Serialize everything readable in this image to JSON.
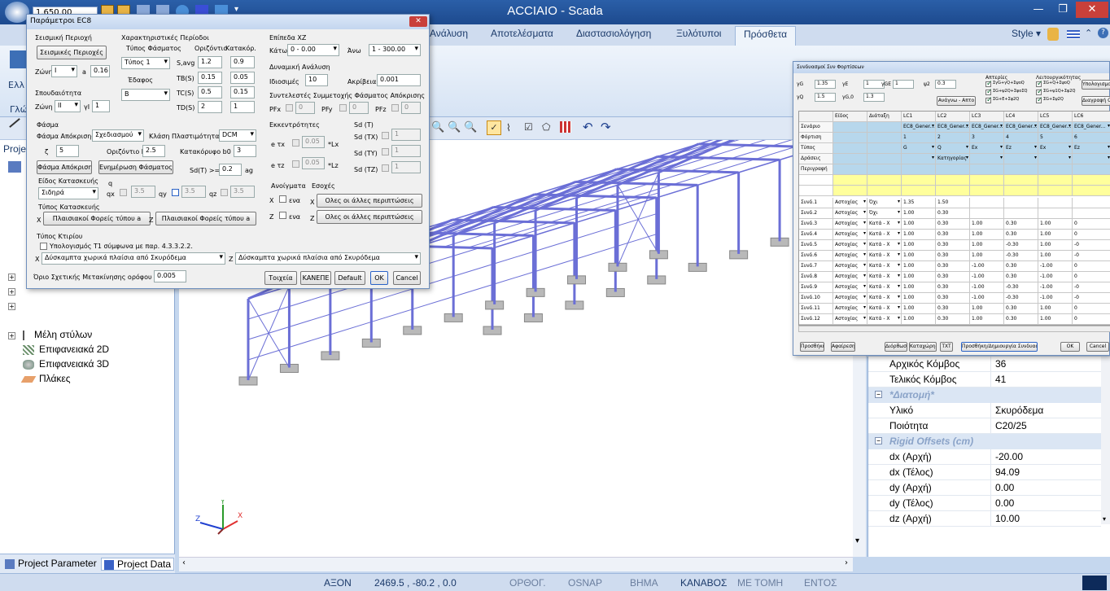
{
  "window": {
    "title": "ACCIAIO - Scada"
  },
  "quick_access": {
    "zoom_value": "1.650.00"
  },
  "ribbon": {
    "tabs": [
      "Ανάλυση",
      "Αποτελέσματα",
      "Διαστασιολόγηση",
      "Ξυλότυποι",
      "Πρόσθετα"
    ],
    "active_tab": "Πρόσθετα",
    "style_label": "Style",
    "left_group_label": "Ελλ",
    "left_group_caption": "Γλώ"
  },
  "left_panel": {
    "header": "Proje",
    "tree": [
      "Μέλη στύλων",
      "Επιφανειακά 2D",
      "Επιφανειακά 3D",
      "Πλάκες"
    ],
    "bottom_tabs": [
      "Project Parameter",
      "Project Data"
    ]
  },
  "status_bar": {
    "axis": "ΑΞΟΝ",
    "coords": "2469.5 , -80.2 , 0.0",
    "items": [
      "ΟΡΘΟΓ.",
      "OSNAP",
      "ΒΗΜΑ",
      "ΚΑΝΑΒΟΣ",
      "ΜΕ ΤΟΜΗ",
      "ΕΝΤΟΣ"
    ],
    "active": "ΚΑΝΑΒΟΣ"
  },
  "axes_labels": {
    "x": "X",
    "y": "Y",
    "z": "Z"
  },
  "properties": {
    "rows_top": [
      {
        "key": "Αρχικός Κόμβος",
        "value": "36"
      },
      {
        "key": "Τελικός Κόμβος",
        "value": "41"
      }
    ],
    "category_section": "*Διατομή*",
    "rows_section": [
      {
        "key": "Υλικό",
        "value": "Σκυρόδεμα"
      },
      {
        "key": "Ποιότητα",
        "value": "C20/25"
      }
    ],
    "category_offsets": "Rigid Offsets (cm)",
    "rows_offsets": [
      {
        "key": "dx (Αρχή)",
        "value": "-20.00"
      },
      {
        "key": "dx (Τέλος)",
        "value": "94.09"
      },
      {
        "key": "dy (Αρχή)",
        "value": "0.00"
      },
      {
        "key": "dy (Τέλος)",
        "value": "0.00"
      },
      {
        "key": "dz (Αρχή)",
        "value": "10.00"
      }
    ]
  },
  "ec8_dialog": {
    "title": "Παράμετροι EC8",
    "seismic_area": {
      "group": "Σεισμική Περιοχή",
      "button": "Σεισμικές Περιοχές",
      "zone_label": "Ζώνη",
      "zone_value": "I",
      "a_label": "a",
      "a_value": "0.16"
    },
    "importance": {
      "group": "Σπουδαιότητα",
      "zone_label": "Ζώνη",
      "zone_value": "II",
      "gamma_label": "γI",
      "gamma_value": "1"
    },
    "char_periods": {
      "group": "Χαρακτηριστικές Περίοδοι",
      "type_label": "Τύπος Φάσματος",
      "type_value": "Τύπος 1",
      "soil_label": "Έδαφος",
      "soil_value": "B",
      "horizontal": "Οριζόντιο",
      "vertical": "Κατακόρ.",
      "rows": [
        {
          "k": "S,avg",
          "h": "1.2",
          "v": "0.9"
        },
        {
          "k": "TB(S)",
          "h": "0.15",
          "v": "0.05"
        },
        {
          "k": "TC(S)",
          "h": "0.5",
          "v": "0.15"
        },
        {
          "k": "TD(S)",
          "h": "2",
          "v": "1"
        }
      ]
    },
    "xz_level": {
      "group": "Επίπεδα XZ",
      "below_label": "Κάτω",
      "below_value": "0 - 0.00",
      "above_label": "Άνω",
      "above_value": "1 - 300.00"
    },
    "dynamic": {
      "group": "Δυναμική Ανάλυση",
      "modes_label": "Ιδιοσιμές",
      "modes_value": "10",
      "accuracy_label": "Ακρίβεια",
      "accuracy_value": "0.001"
    },
    "participation": {
      "group": "Συντελεστές Συμμετοχής Φάσματος Απόκρισης",
      "items": [
        {
          "k": "PFx",
          "v": "0"
        },
        {
          "k": "PFy",
          "v": "0"
        },
        {
          "k": "PFz",
          "v": "0"
        }
      ]
    },
    "spectrum": {
      "group": "Φάσμα",
      "response_label": "Φάσμα Απόκρισης",
      "response_value": "Σχεδιασμού",
      "ductility_label": "Κλάση Πλαστιμότητας",
      "ductility_value": "DCM",
      "zeta_label": "ζ",
      "zeta_value": "5",
      "hb0_label": "Οριζόντιο b0",
      "hb0_value": "2.5",
      "vb0_label": "Κατακόρυφο b0",
      "vb0_value": "3",
      "btn_response": "Φάσμα Απόκρισης",
      "btn_update": "Ενημέρωση Φάσματος",
      "sd_label": "Sd(T) >=",
      "sd_value": "0.2",
      "sd_unit": "ag"
    },
    "eccentricities": {
      "group": "Εκκεντρότητες",
      "etx": "e τx",
      "etx_value": "0.05",
      "etx_unit": "*Lx",
      "etz": "e τz",
      "etz_value": "0.05",
      "etz_unit": "*Lz"
    },
    "sdt": {
      "group": "Sd (T)",
      "items": [
        {
          "k": "Sd (TX)",
          "v": "1"
        },
        {
          "k": "Sd (TY)",
          "v": "1"
        },
        {
          "k": "Sd (TZ)",
          "v": "1"
        }
      ]
    },
    "construction": {
      "group": "Είδος Κατασκευής",
      "value": "Σιδηρά",
      "q_label": "q",
      "qx": "qx",
      "qx_value": "3.5",
      "qy": "qy",
      "qy_value": "3.5",
      "qz": "qz",
      "qz_value": "3.5"
    },
    "openings": {
      "group": "Ανοίγματα",
      "x_label": "X",
      "x_text": "ενα",
      "z_label": "Z",
      "z_text": "ενα"
    },
    "recesses": {
      "group": "Εσοχές",
      "x_label": "X",
      "x_btn": "Ολες οι άλλες περιπτώσεις",
      "z_label": "Z",
      "z_btn": "Ολες οι άλλες περιπτώσεις"
    },
    "construction_type": {
      "group": "Τύπος Κατασκευής",
      "x_label": "X",
      "x_btn": "Πλαισιακοί Φορείς τύπου a",
      "z_label": "Z",
      "z_btn": "Πλαισιακοί Φορείς τύπου a"
    },
    "building_type": {
      "group": "Τύπος Κτιρίου",
      "check_label": "Υπολογισμός T1 σύμφωνα με παρ. 4.3.3.2.2.",
      "x_label": "X",
      "x_value": "Δύσκαμπτα χωρικά πλαίσια από Σκυρόδεμα",
      "z_label": "Z",
      "z_value": "Δύσκαμπτα χωρικά πλαίσια από Σκυρόδεμα"
    },
    "drift_label": "Όριο Σχετικής Μετακίνησης ορόφου",
    "drift_value": "0.005",
    "buttons": {
      "wall": "Τοιχεία",
      "none": "ΚΑΝΕΠΕ",
      "default": "Default",
      "ok": "OK",
      "cancel": "Cancel"
    }
  },
  "combos_dialog": {
    "title": "Συνδυασμοί Συν Φορτίσεων",
    "factors": [
      {
        "k": "γG",
        "v": "1.35"
      },
      {
        "k": "γE",
        "v": "1"
      },
      {
        "k": "γGE",
        "v": "1"
      },
      {
        "k": "ψ2",
        "v": "0.3"
      },
      {
        "k": "γQ",
        "v": "1.5"
      },
      {
        "k": "γG,0",
        "v": "1.3"
      }
    ],
    "btn_read": "Ανάγνω - Απτο",
    "checks_a_title": "Απτερίες",
    "checks_a": [
      "ΣγG+γQ+ΣψοQ",
      "ΣG+ψ2Q+ΣψοΣQ",
      "ΣG+E+Σψ2Q"
    ],
    "checks_b_title": "Λειτουργικότητας",
    "checks_b": [
      "ΣG+Q+ΣψοQ",
      "ΣG+ψ1Q+Σψ2Q",
      "ΣG+Σψ2Q"
    ],
    "btn_calc": "Υπολογισμοί",
    "btn_display": "Διαγραφή Ολ.",
    "col_headers": [
      "Είδος",
      "Διάταξη",
      "LC1",
      "LC2",
      "LC3",
      "LC4",
      "LC5",
      "LC6"
    ],
    "row_labels": [
      "Σενάριο",
      "Φόρτιση",
      "Τύπος",
      "Δράσεις",
      "Περιγραφή"
    ],
    "scenario_row": [
      "EC8_Gener...",
      "EC8_Gener...",
      "EC8_Gener...",
      "EC8_Gener...",
      "EC8_Gener...",
      "EC8_Gener..."
    ],
    "load_row": [
      "1",
      "2",
      "3",
      "4",
      "5",
      "6"
    ],
    "type_row": [
      "G",
      "Q",
      "Ex",
      "Ez",
      "Ex",
      "Ez"
    ],
    "action_row": [
      "",
      "Κατηγορίας",
      "",
      "",
      "",
      ""
    ],
    "combos": [
      {
        "name": "Συνδ.1",
        "kind": "Αστοχίας",
        "arr": "Όχι",
        "v": [
          "1.35",
          "1.50",
          "",
          "",
          "",
          ""
        ]
      },
      {
        "name": "Συνδ.2",
        "kind": "Αστοχίας",
        "arr": "Όχι",
        "v": [
          "1.00",
          "0.30",
          "",
          "",
          "",
          ""
        ]
      },
      {
        "name": "Συνδ.3",
        "kind": "Αστοχίας",
        "arr": "Κατά - X",
        "v": [
          "1.00",
          "0.30",
          "1.00",
          "0.30",
          "1.00",
          "0"
        ]
      },
      {
        "name": "Συνδ.4",
        "kind": "Αστοχίας",
        "arr": "Κατά - X",
        "v": [
          "1.00",
          "0.30",
          "1.00",
          "0.30",
          "1.00",
          "0"
        ]
      },
      {
        "name": "Συνδ.5",
        "kind": "Αστοχίας",
        "arr": "Κατά - X",
        "v": [
          "1.00",
          "0.30",
          "1.00",
          "-0.30",
          "1.00",
          "-0"
        ]
      },
      {
        "name": "Συνδ.6",
        "kind": "Αστοχίας",
        "arr": "Κατά - X",
        "v": [
          "1.00",
          "0.30",
          "1.00",
          "-0.30",
          "1.00",
          "-0"
        ]
      },
      {
        "name": "Συνδ.7",
        "kind": "Αστοχίας",
        "arr": "Κατά - X",
        "v": [
          "1.00",
          "0.30",
          "-1.00",
          "0.30",
          "-1.00",
          "0"
        ]
      },
      {
        "name": "Συνδ.8",
        "kind": "Αστοχίας",
        "arr": "Κατά - X",
        "v": [
          "1.00",
          "0.30",
          "-1.00",
          "0.30",
          "-1.00",
          "0"
        ]
      },
      {
        "name": "Συνδ.9",
        "kind": "Αστοχίας",
        "arr": "Κατά - X",
        "v": [
          "1.00",
          "0.30",
          "-1.00",
          "-0.30",
          "-1.00",
          "-0"
        ]
      },
      {
        "name": "Συνδ.10",
        "kind": "Αστοχίας",
        "arr": "Κατά - X",
        "v": [
          "1.00",
          "0.30",
          "-1.00",
          "-0.30",
          "-1.00",
          "-0"
        ]
      },
      {
        "name": "Συνδ.11",
        "kind": "Αστοχίας",
        "arr": "Κατά - X",
        "v": [
          "1.00",
          "0.30",
          "1.00",
          "0.30",
          "1.00",
          "0"
        ]
      },
      {
        "name": "Συνδ.12",
        "kind": "Αστοχίας",
        "arr": "Κατά - X",
        "v": [
          "1.00",
          "0.30",
          "1.00",
          "0.30",
          "1.00",
          "0"
        ]
      }
    ],
    "buttons": {
      "add": "Προσθήκη",
      "remove": "Αφαίρεση",
      "edit": "Διόρθωση",
      "delete": "Καταχώρηση",
      "txt": "TXT",
      "create": "Προσθήκη/Δημιουργία Συνδυασμού",
      "ok": "OK",
      "cancel": "Cancel"
    }
  },
  "colors": {
    "structure": "#6b6fd6",
    "footing": "#b9b9b9",
    "accent": "#1d4a8e"
  }
}
